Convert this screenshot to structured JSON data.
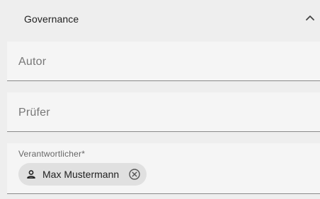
{
  "panel": {
    "title": "Governance",
    "collapse_icon": "chevron-up-icon"
  },
  "fields": {
    "autor": {
      "label": "Autor",
      "value": ""
    },
    "pruefer": {
      "label": "Prüfer",
      "value": ""
    },
    "verantwortlicher": {
      "label": "Verantwortlicher*",
      "chips": [
        {
          "text": "Max Mustermann",
          "icon": "person-icon",
          "remove_icon": "close-circle-icon"
        }
      ]
    }
  },
  "colors": {
    "background": "#eeeeee",
    "field_background": "#f5f5f5",
    "chip_background": "#e0e0e0",
    "text": "#212121",
    "label": "#777777",
    "underline": "#8a8a8a"
  }
}
